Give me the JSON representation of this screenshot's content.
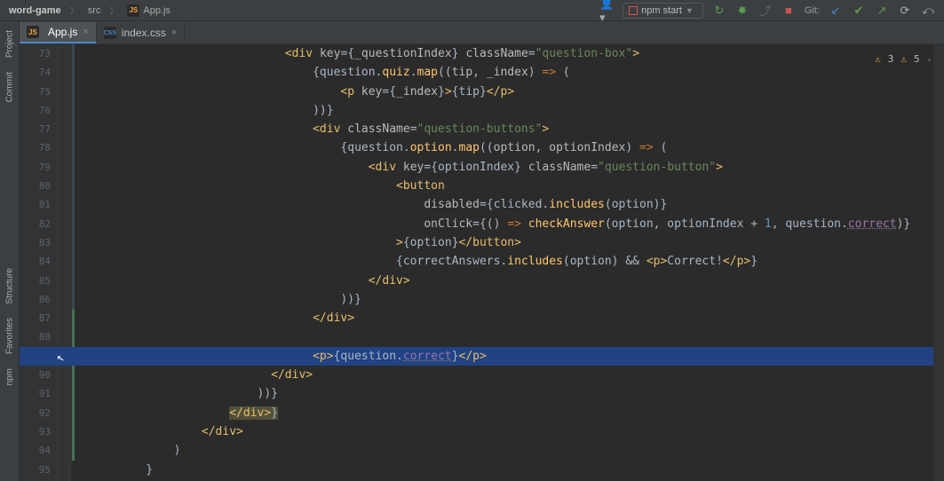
{
  "breadcrumb": {
    "project": "word-game",
    "folder": "src",
    "file": "App.js"
  },
  "run_config": "npm start",
  "vcs_label": "Git:",
  "tabs": [
    {
      "label": "App.js",
      "icon": "js",
      "active": true
    },
    {
      "label": "index.css",
      "icon": "css",
      "active": false
    }
  ],
  "sidebar": {
    "items": [
      "Project",
      "Commit",
      "Structure",
      "Favorites",
      "npm"
    ]
  },
  "lint": {
    "warn_a": "3",
    "warn_b": "5"
  },
  "editor": {
    "first_line": 73,
    "highlighted_line": 89,
    "mods": [
      {
        "type": "blue",
        "from": 73,
        "to": 86
      },
      {
        "type": "green",
        "from": 87,
        "to": 94
      }
    ],
    "boxed_lines": [
      92
    ]
  },
  "code": {
    "lines": [
      {
        "n": 73,
        "indent": 30,
        "tokens": [
          [
            "tag",
            "<div "
          ],
          [
            "attr",
            "key"
          ],
          [
            "txt",
            "={"
          ],
          [
            "attr",
            "_questionIndex"
          ],
          [
            "txt",
            "} "
          ],
          [
            "attr",
            "className"
          ],
          [
            "txt",
            "="
          ],
          [
            "str",
            "\"question-box\""
          ],
          [
            "tag",
            ">"
          ]
        ]
      },
      {
        "n": 74,
        "indent": 34,
        "tokens": [
          [
            "txt",
            "{question."
          ],
          [
            "fn",
            "quiz"
          ],
          [
            "txt",
            "."
          ],
          [
            "fn",
            "map"
          ],
          [
            "txt",
            "(("
          ],
          [
            "attr",
            "tip"
          ],
          [
            "txt",
            ", "
          ],
          [
            "attr",
            "_index"
          ],
          [
            "txt",
            ") "
          ],
          [
            "kw",
            "=>"
          ],
          [
            "txt",
            " ("
          ]
        ]
      },
      {
        "n": 75,
        "indent": 38,
        "tokens": [
          [
            "tag",
            "<p "
          ],
          [
            "attr",
            "key"
          ],
          [
            "txt",
            "={"
          ],
          [
            "attr",
            "_index"
          ],
          [
            "txt",
            "}"
          ],
          [
            "tag",
            ">"
          ],
          [
            "txt",
            "{tip}"
          ],
          [
            "tag",
            "</p>"
          ]
        ]
      },
      {
        "n": 76,
        "indent": 34,
        "tokens": [
          [
            "txt",
            "))}"
          ]
        ]
      },
      {
        "n": 77,
        "indent": 34,
        "tokens": [
          [
            "tag",
            "<div "
          ],
          [
            "attr",
            "className"
          ],
          [
            "txt",
            "="
          ],
          [
            "str",
            "\"question-buttons\""
          ],
          [
            "tag",
            ">"
          ]
        ]
      },
      {
        "n": 78,
        "indent": 38,
        "tokens": [
          [
            "txt",
            "{question."
          ],
          [
            "fn",
            "option"
          ],
          [
            "txt",
            "."
          ],
          [
            "fn",
            "map"
          ],
          [
            "txt",
            "(("
          ],
          [
            "attr",
            "option"
          ],
          [
            "txt",
            ", "
          ],
          [
            "attr",
            "optionIndex"
          ],
          [
            "txt",
            ") "
          ],
          [
            "kw",
            "=>"
          ],
          [
            "txt",
            " ("
          ]
        ]
      },
      {
        "n": 79,
        "indent": 42,
        "tokens": [
          [
            "tag",
            "<div "
          ],
          [
            "attr",
            "key"
          ],
          [
            "txt",
            "={optionIndex} "
          ],
          [
            "attr",
            "className"
          ],
          [
            "txt",
            "="
          ],
          [
            "str",
            "\"question-button\""
          ],
          [
            "tag",
            ">"
          ]
        ]
      },
      {
        "n": 80,
        "indent": 46,
        "tokens": [
          [
            "tag",
            "<button"
          ]
        ]
      },
      {
        "n": 81,
        "indent": 50,
        "tokens": [
          [
            "attr",
            "disabled"
          ],
          [
            "txt",
            "={clicked."
          ],
          [
            "fn",
            "includes"
          ],
          [
            "txt",
            "(option)}"
          ]
        ]
      },
      {
        "n": 82,
        "indent": 50,
        "tokens": [
          [
            "attr",
            "onClick"
          ],
          [
            "txt",
            "={() "
          ],
          [
            "kw",
            "=>"
          ],
          [
            "txt",
            " "
          ],
          [
            "fn",
            "checkAnswer"
          ],
          [
            "txt",
            "(option, optionIndex + "
          ],
          [
            "num",
            "1"
          ],
          [
            "txt",
            ", question."
          ],
          [
            "propU",
            "correct"
          ],
          [
            "txt",
            ")}"
          ]
        ]
      },
      {
        "n": 83,
        "indent": 46,
        "tokens": [
          [
            "tag",
            ">"
          ],
          [
            "txt",
            "{option}"
          ],
          [
            "tag",
            "</button>"
          ]
        ]
      },
      {
        "n": 84,
        "indent": 46,
        "tokens": [
          [
            "txt",
            "{correctAnswers."
          ],
          [
            "fn",
            "includes"
          ],
          [
            "txt",
            "(option) && "
          ],
          [
            "tag",
            "<p>"
          ],
          [
            "txt",
            "Correct!"
          ],
          [
            "tag",
            "</p>"
          ],
          [
            "txt",
            "}"
          ]
        ]
      },
      {
        "n": 85,
        "indent": 42,
        "tokens": [
          [
            "tag",
            "</div>"
          ]
        ]
      },
      {
        "n": 86,
        "indent": 38,
        "tokens": [
          [
            "txt",
            "))}"
          ]
        ]
      },
      {
        "n": 87,
        "indent": 34,
        "tokens": [
          [
            "tag",
            "</div>"
          ]
        ]
      },
      {
        "n": 88,
        "indent": 0,
        "tokens": []
      },
      {
        "n": 89,
        "indent": 34,
        "tokens": [
          [
            "tag",
            "<p>"
          ],
          [
            "txt",
            "{question."
          ],
          [
            "propU",
            "correct"
          ],
          [
            "txt",
            "}"
          ],
          [
            "tag",
            "</p>"
          ]
        ]
      },
      {
        "n": 90,
        "indent": 28,
        "tokens": [
          [
            "tag",
            "</div>"
          ]
        ]
      },
      {
        "n": 91,
        "indent": 26,
        "tokens": [
          [
            "txt",
            "))}"
          ]
        ]
      },
      {
        "n": 92,
        "indent": 22,
        "tokens": [
          [
            "tag",
            "</div>"
          ],
          [
            "txt",
            "}"
          ]
        ]
      },
      {
        "n": 93,
        "indent": 18,
        "tokens": [
          [
            "tag",
            "</div>"
          ]
        ]
      },
      {
        "n": 94,
        "indent": 14,
        "tokens": [
          [
            "txt",
            ")"
          ]
        ]
      },
      {
        "n": 95,
        "indent": 10,
        "tokens": [
          [
            "txt",
            "}"
          ]
        ]
      }
    ]
  }
}
